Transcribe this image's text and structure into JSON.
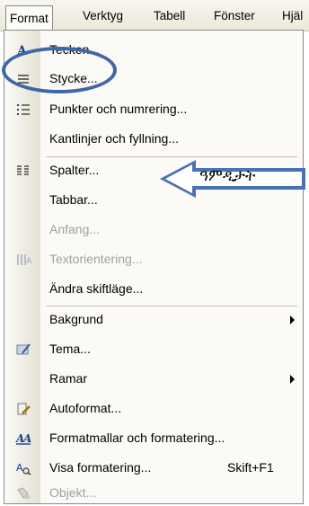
{
  "menubar": {
    "items": [
      "Format",
      "Verktyg",
      "Tabell",
      "Fönster",
      "Hjäl"
    ]
  },
  "dropdown": {
    "items": [
      {
        "label": "Tecken...",
        "icon": "font-icon",
        "disabled": false
      },
      {
        "label": "Stycke...",
        "icon": "paragraph-icon",
        "disabled": false
      },
      {
        "label": "Punkter och numrering...",
        "icon": "bullets-icon",
        "disabled": false
      },
      {
        "label": "Kantlinjer och fyllning...",
        "icon": "",
        "disabled": false
      },
      {
        "label": "Spalter...",
        "icon": "columns-icon",
        "disabled": false
      },
      {
        "label": "Tabbar...",
        "icon": "",
        "disabled": false
      },
      {
        "label": "Anfang...",
        "icon": "",
        "disabled": true
      },
      {
        "label": "Textorientering...",
        "icon": "text-direction-icon",
        "disabled": true
      },
      {
        "label": "Ändra skiftläge...",
        "icon": "",
        "disabled": false
      },
      {
        "label": "Bakgrund",
        "icon": "",
        "disabled": false,
        "submenu": true
      },
      {
        "label": "Tema...",
        "icon": "theme-icon",
        "disabled": false
      },
      {
        "label": "Ramar",
        "icon": "",
        "disabled": false,
        "submenu": true
      },
      {
        "label": "Autoformat...",
        "icon": "autoformat-icon",
        "disabled": false
      },
      {
        "label": "Formatmallar och formatering...",
        "icon": "styles-icon",
        "disabled": false
      },
      {
        "label": "Visa formatering...",
        "icon": "reveal-formatting-icon",
        "disabled": false,
        "shortcut": "Skift+F1"
      },
      {
        "label": "Objekt...",
        "icon": "object-icon",
        "disabled": true
      }
    ]
  },
  "annotation": {
    "arrow_text": "ዓምዲታት",
    "ellipse_color": "#3d67a8",
    "arrow_color": "#4a72b0"
  }
}
